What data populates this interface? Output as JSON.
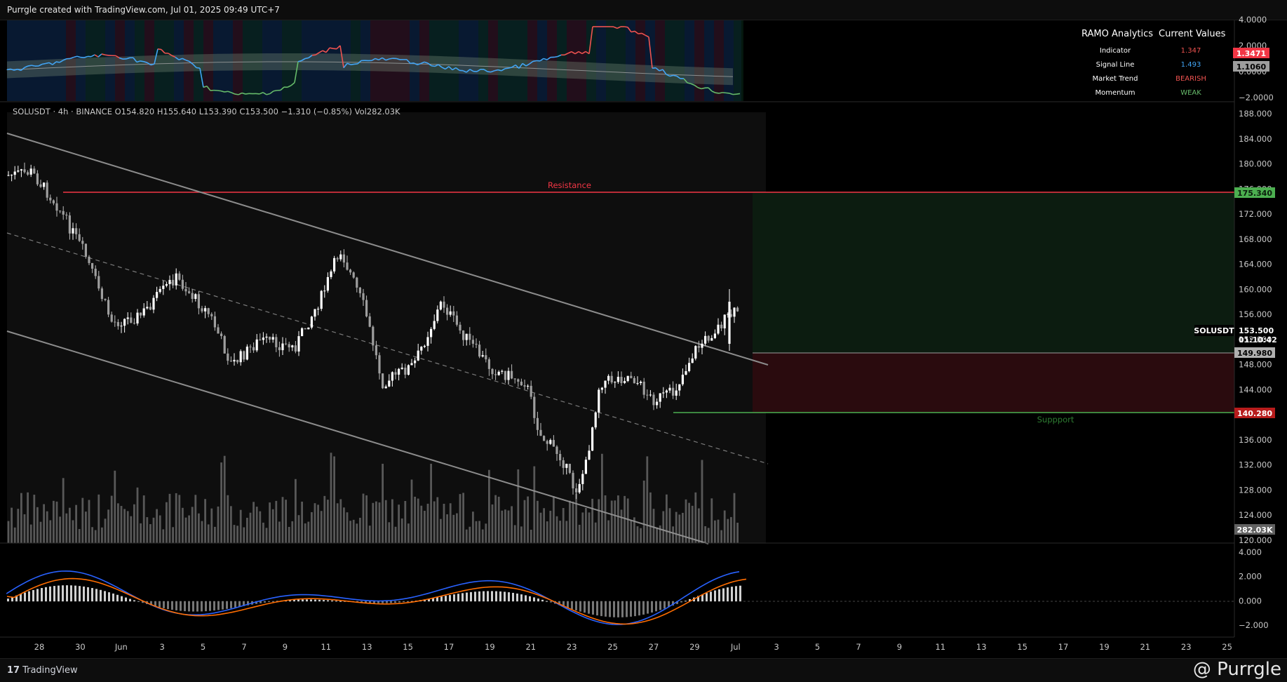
{
  "header": {
    "title": "Purrgle created with TradingView.com, Jul 01, 2025 09:49 UTC+7"
  },
  "symbol": {
    "legend": "SOLUSDT · 4h · BINANCE  O154.820  H155.640  L153.390  C153.500  −1.310 (−0.85%)  Vol282.03K",
    "ticker": "SOLUSDT",
    "price": "153.500",
    "countdown": "01:10:42"
  },
  "levels": {
    "resistance_label": "Resistance",
    "support_label": "Suppport",
    "resistance_value": "175.340",
    "entry_value": "149.980",
    "support_value": "140.280",
    "volume_value": "282.03K"
  },
  "ramo": {
    "title": "RAMO Analytics",
    "col2": "Current Values",
    "rows": [
      {
        "k": "Indicator",
        "v": "1.347",
        "color": "#ef5350"
      },
      {
        "k": "Signal Line",
        "v": "1.493",
        "color": "#42a5f5"
      },
      {
        "k": "Market Trend",
        "v": "BEARISH",
        "color": "#ef5350"
      },
      {
        "k": "Momentum",
        "v": "WEAK",
        "color": "#66bb6a"
      }
    ],
    "indicator_tag": "1.3471",
    "signal_tag": "1.1060"
  },
  "indicator_axis": [
    "4.0000",
    "2.0000",
    "0.0000",
    "−2.0000"
  ],
  "price_axis": [
    "188.000",
    "184.000",
    "180.000",
    "176.000",
    "172.000",
    "168.000",
    "164.000",
    "160.000",
    "156.000",
    "152.000",
    "148.000",
    "144.000",
    "140.000",
    "136.000",
    "132.000",
    "128.000",
    "124.000",
    "120.000"
  ],
  "macd_axis": [
    "4.000",
    "2.000",
    "0.000",
    "−2.000"
  ],
  "time_axis": [
    "28",
    "30",
    "Jun",
    "3",
    "5",
    "7",
    "9",
    "11",
    "13",
    "15",
    "17",
    "19",
    "21",
    "23",
    "25",
    "27",
    "29",
    "Jul",
    "3",
    "5",
    "7",
    "9",
    "11",
    "13",
    "15",
    "17",
    "19",
    "21",
    "23",
    "25"
  ],
  "footer": {
    "brand": "TradingView",
    "watermark": "@ Purrgle"
  },
  "colors": {
    "bull": "#ffffff",
    "bear": "#bdbdbd",
    "resistance": "#f23645",
    "support": "#4caf50"
  }
}
